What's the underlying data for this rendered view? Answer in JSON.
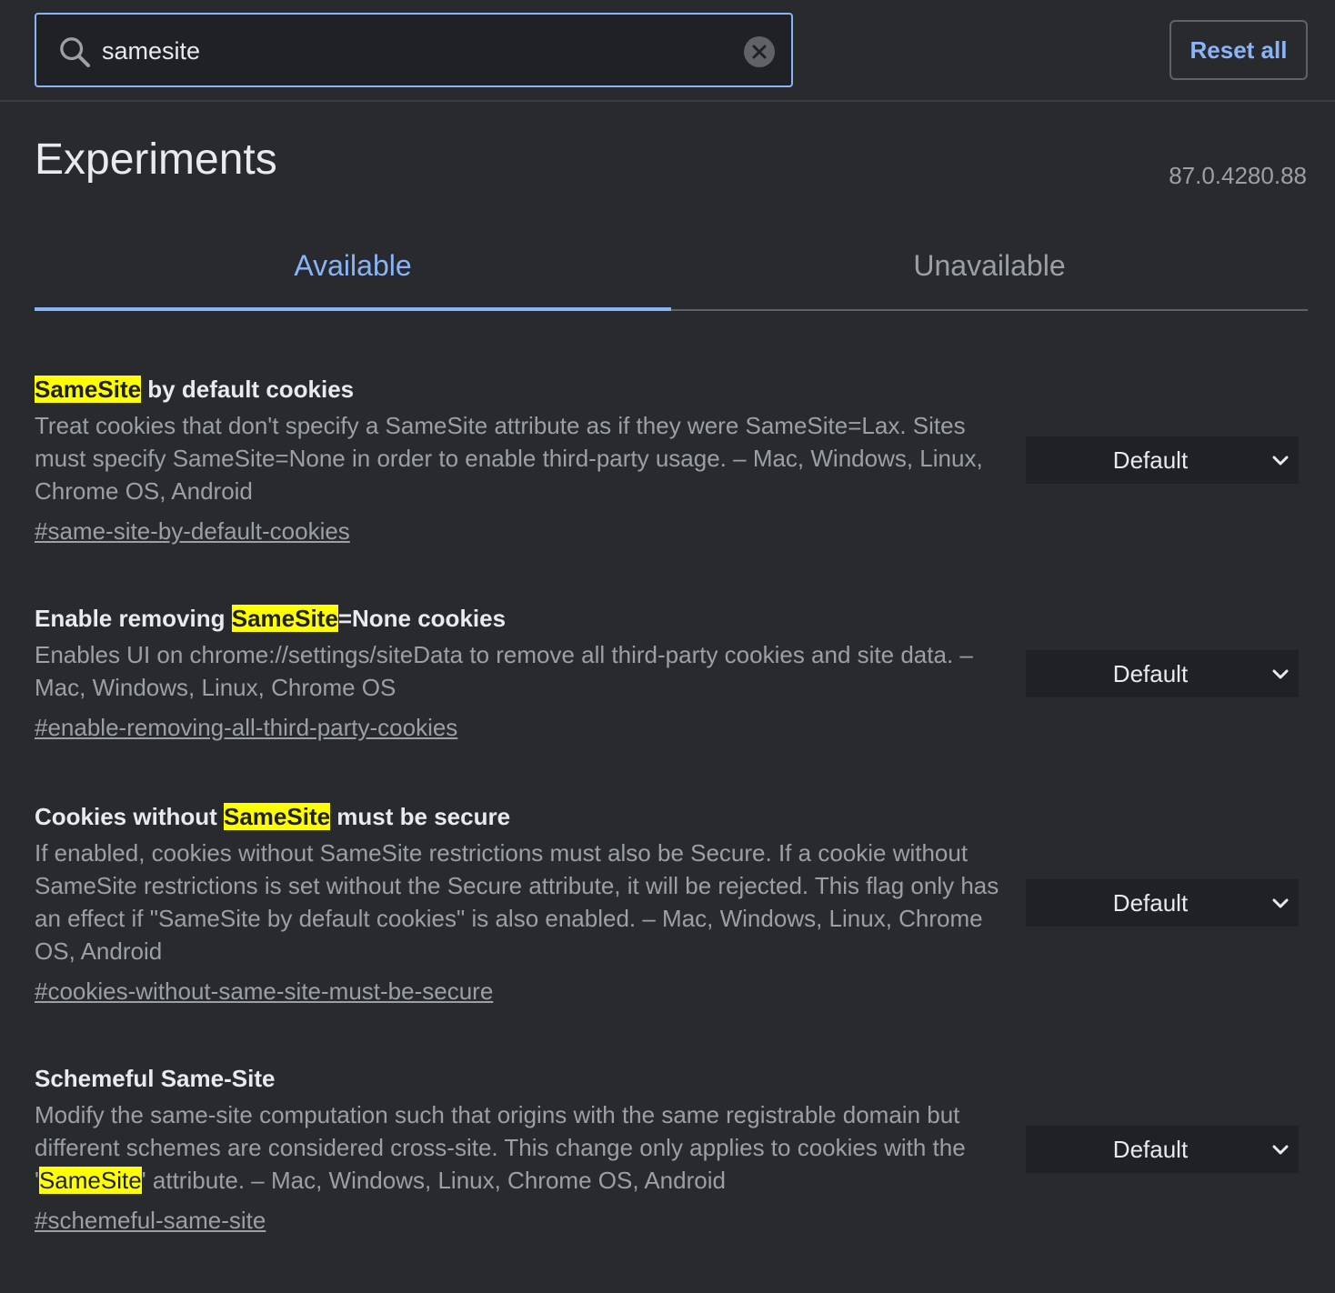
{
  "search": {
    "value": "samesite",
    "placeholder": "Search flags"
  },
  "header": {
    "reset_label": "Reset all"
  },
  "page": {
    "title": "Experiments",
    "version": "87.0.4280.88"
  },
  "tabs": [
    {
      "label": "Available",
      "active": true
    },
    {
      "label": "Unavailable",
      "active": false
    }
  ],
  "experiments": [
    {
      "title_before": "",
      "title_highlight": "SameSite",
      "title_after": " by default cookies",
      "description": "Treat cookies that don't specify a SameSite attribute as if they were SameSite=Lax. Sites must specify SameSite=None in order to enable third-party usage. – Mac, Windows, Linux, Chrome OS, Android",
      "link": "#same-site-by-default-cookies",
      "value": "Default"
    },
    {
      "title_before": "Enable removing ",
      "title_highlight": "SameSite",
      "title_after": "=None cookies",
      "description": "Enables UI on chrome://settings/siteData to remove all third-party cookies and site data. – Mac, Windows, Linux, Chrome OS",
      "link": "#enable-removing-all-third-party-cookies",
      "value": "Default"
    },
    {
      "title_before": "Cookies without ",
      "title_highlight": "SameSite",
      "title_after": " must be secure",
      "description": "If enabled, cookies without SameSite restrictions must also be Secure. If a cookie without SameSite restrictions is set without the Secure attribute, it will be rejected. This flag only has an effect if \"SameSite by default cookies\" is also enabled. – Mac, Windows, Linux, Chrome OS, Android",
      "link": "#cookies-without-same-site-must-be-secure",
      "value": "Default"
    },
    {
      "title": "Schemeful Same-Site",
      "description_before": "Modify the same-site computation such that origins with the same registrable domain but different schemes are considered cross-site. This change only applies to cookies with the '",
      "description_highlight": "SameSite",
      "description_after": "' attribute. – Mac, Windows, Linux, Chrome OS, Android",
      "link": "#schemeful-same-site",
      "value": "Default"
    }
  ],
  "colors": {
    "background": "#292a2d",
    "accent": "#8ab4f8",
    "highlight": "#ffff00",
    "secondary_text": "#9aa0a6",
    "select_background": "#202124"
  }
}
